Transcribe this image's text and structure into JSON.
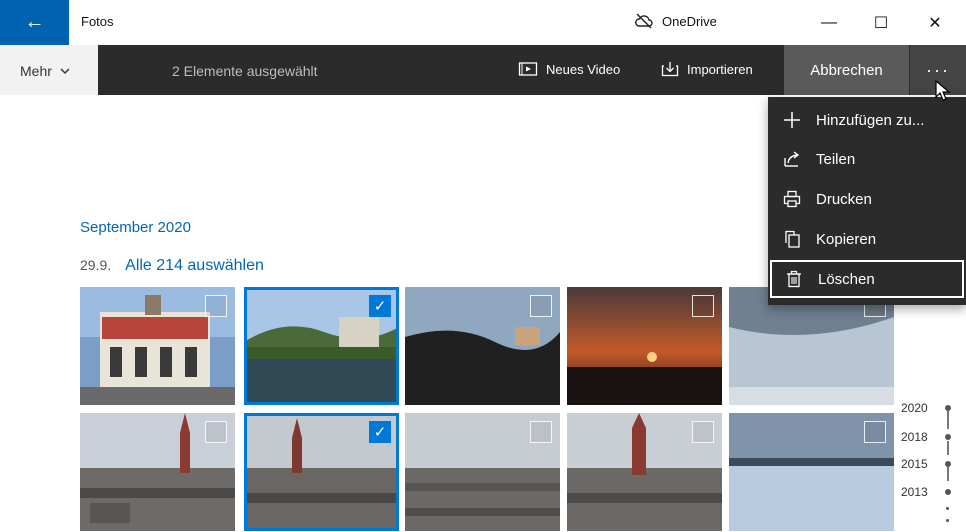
{
  "titlebar": {
    "app_title": "Fotos",
    "onedrive_label": "OneDrive",
    "back_icon": "arrow-left-icon",
    "minimize": "—",
    "maximize": "☐",
    "close": "✕"
  },
  "commandbar": {
    "mehr_label": "Mehr",
    "selection_text": "2 Elemente ausgewählt",
    "new_video_label": "Neues Video",
    "import_label": "Importieren",
    "cancel_label": "Abbrechen",
    "more_label": "···"
  },
  "content": {
    "month_label": "September 2020",
    "day_label": "29.9.",
    "select_all_label": "Alle 214 auswählen",
    "photos": [
      {
        "scene": "building",
        "selected": false
      },
      {
        "scene": "lake-castle",
        "selected": true
      },
      {
        "scene": "hills-dusk",
        "selected": false
      },
      {
        "scene": "sunset",
        "selected": false
      },
      {
        "scene": "sky",
        "selected": false
      },
      {
        "scene": "city-church",
        "selected": false
      },
      {
        "scene": "city-church",
        "selected": true
      },
      {
        "scene": "city-rooftops",
        "selected": false
      },
      {
        "scene": "city-church",
        "selected": false
      },
      {
        "scene": "sky-water",
        "selected": false
      }
    ]
  },
  "timeline": {
    "years": [
      "2020",
      "2018",
      "2015",
      "2013"
    ]
  },
  "menu": {
    "items": [
      {
        "label": "Hinzufügen zu...",
        "icon": "plus-icon"
      },
      {
        "label": "Teilen",
        "icon": "share-icon"
      },
      {
        "label": "Drucken",
        "icon": "printer-icon"
      },
      {
        "label": "Kopieren",
        "icon": "copy-icon"
      },
      {
        "label": "Löschen",
        "icon": "trash-icon"
      }
    ]
  },
  "colors": {
    "accent": "#0078d7",
    "back_button": "#0063b1",
    "commandbar": "#2b2b2b",
    "menu_bg": "#2b2b2b"
  }
}
